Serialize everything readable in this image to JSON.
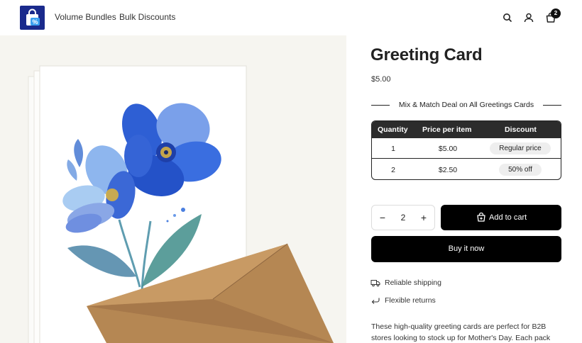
{
  "header": {
    "nav": [
      "Volume Bundles",
      "Bulk Discounts"
    ],
    "cart_count": "2"
  },
  "product": {
    "title": "Greeting Card",
    "price": "$5.00",
    "deal_heading": "Mix & Match Deal on All Greetings Cards",
    "table": {
      "headers": [
        "Quantity",
        "Price per item",
        "Discount"
      ],
      "rows": [
        {
          "quantity": "1",
          "price": "$5.00",
          "discount": "Regular price"
        },
        {
          "quantity": "2",
          "price": "$2.50",
          "discount": "50% off"
        }
      ]
    },
    "quantity": "2",
    "qty_minus": "−",
    "qty_plus": "+",
    "add_to_cart": "Add to cart",
    "buy_now": "Buy it now",
    "features": [
      "Reliable shipping",
      "Flexible returns"
    ],
    "description": "These high-quality greeting cards are perfect for B2B stores looking to stock up for Mother's Day. Each pack"
  },
  "colors": {
    "button": "#000000",
    "table_header": "#2c2c2c",
    "logo_bg": "#1a2a8c",
    "media_bg": "#f6f5f0",
    "flower": "#2f63d8",
    "envelope": "#b58753"
  }
}
